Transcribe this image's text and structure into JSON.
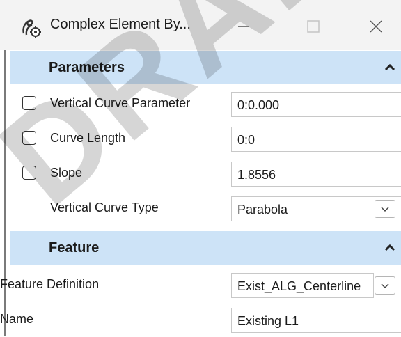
{
  "window": {
    "title": "Complex Element By...",
    "icon": "complex-element-icon"
  },
  "sections": {
    "parameters": {
      "title": "Parameters",
      "rows": [
        {
          "label": "Vertical Curve Parameter",
          "value": "0:0.000",
          "checked": false
        },
        {
          "label": "Curve Length",
          "value": "0:0",
          "checked": false
        },
        {
          "label": "Slope",
          "value": "1.8556",
          "checked": false
        },
        {
          "label": "Vertical Curve Type",
          "value": "Parabola"
        }
      ]
    },
    "feature": {
      "title": "Feature",
      "rows": [
        {
          "label": "Feature Definition",
          "value": "Exist_ALG_Centerline"
        },
        {
          "label": "Name",
          "value": "Existing L1"
        }
      ]
    }
  },
  "watermark": "DRAFT",
  "colors": {
    "section_header": "#cde3f7",
    "titlebar": "#f3f3f3"
  }
}
